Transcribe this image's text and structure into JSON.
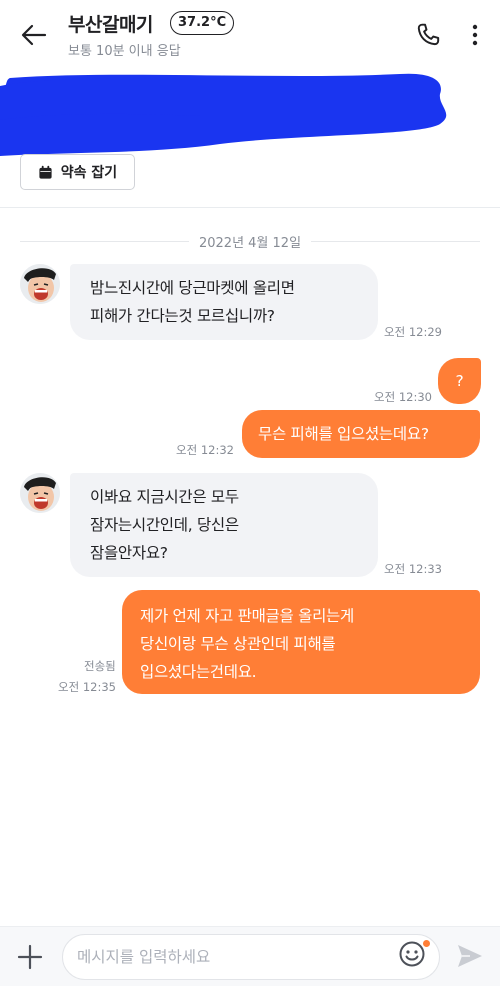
{
  "header": {
    "title": "부산갈매기",
    "temperature": "37.2°C",
    "subtitle": "보통 10분 이내 응답",
    "icons": {
      "back": "arrow-left-icon",
      "call": "phone-icon",
      "more": "more-vertical-icon"
    }
  },
  "product": {
    "appointment_label": "약속 잡기",
    "appointment_icon": "calendar-icon",
    "redaction_color": "#1a35f0"
  },
  "chat": {
    "date": "2022년 4월 12일",
    "messages": [
      {
        "from": "other",
        "text": [
          "밤느진시간에  당근마켓에 올리면",
          "피해가 간다는것 모르십니까?"
        ],
        "time": "오전 12:29"
      },
      {
        "from": "me",
        "text": [
          "?"
        ],
        "time": "오전 12:30"
      },
      {
        "from": "me",
        "text": [
          "무슨 피해를 입으셨는데요?"
        ],
        "time": "오전 12:32"
      },
      {
        "from": "other",
        "text": [
          "이봐요 지금시간은 모두",
          "잠자는시간인데, 당신은",
          "잠을안자요?"
        ],
        "time": "오전 12:33"
      },
      {
        "from": "me",
        "text": [
          "제가 언제 자고 판매글을 올리는게",
          "당신이랑 무슨 상관인데 피해를",
          "입으셨다는건데요."
        ],
        "status": "전송됨",
        "time": "오전 12:35"
      }
    ]
  },
  "input": {
    "placeholder": "메시지를 입력하세요",
    "icons": {
      "plus": "plus-icon",
      "emoji": "emoji-icon",
      "send": "send-icon"
    }
  },
  "colors": {
    "accent": "#ff7e36",
    "incoming_bubble": "#f2f3f6",
    "muted_text": "#868b94"
  }
}
